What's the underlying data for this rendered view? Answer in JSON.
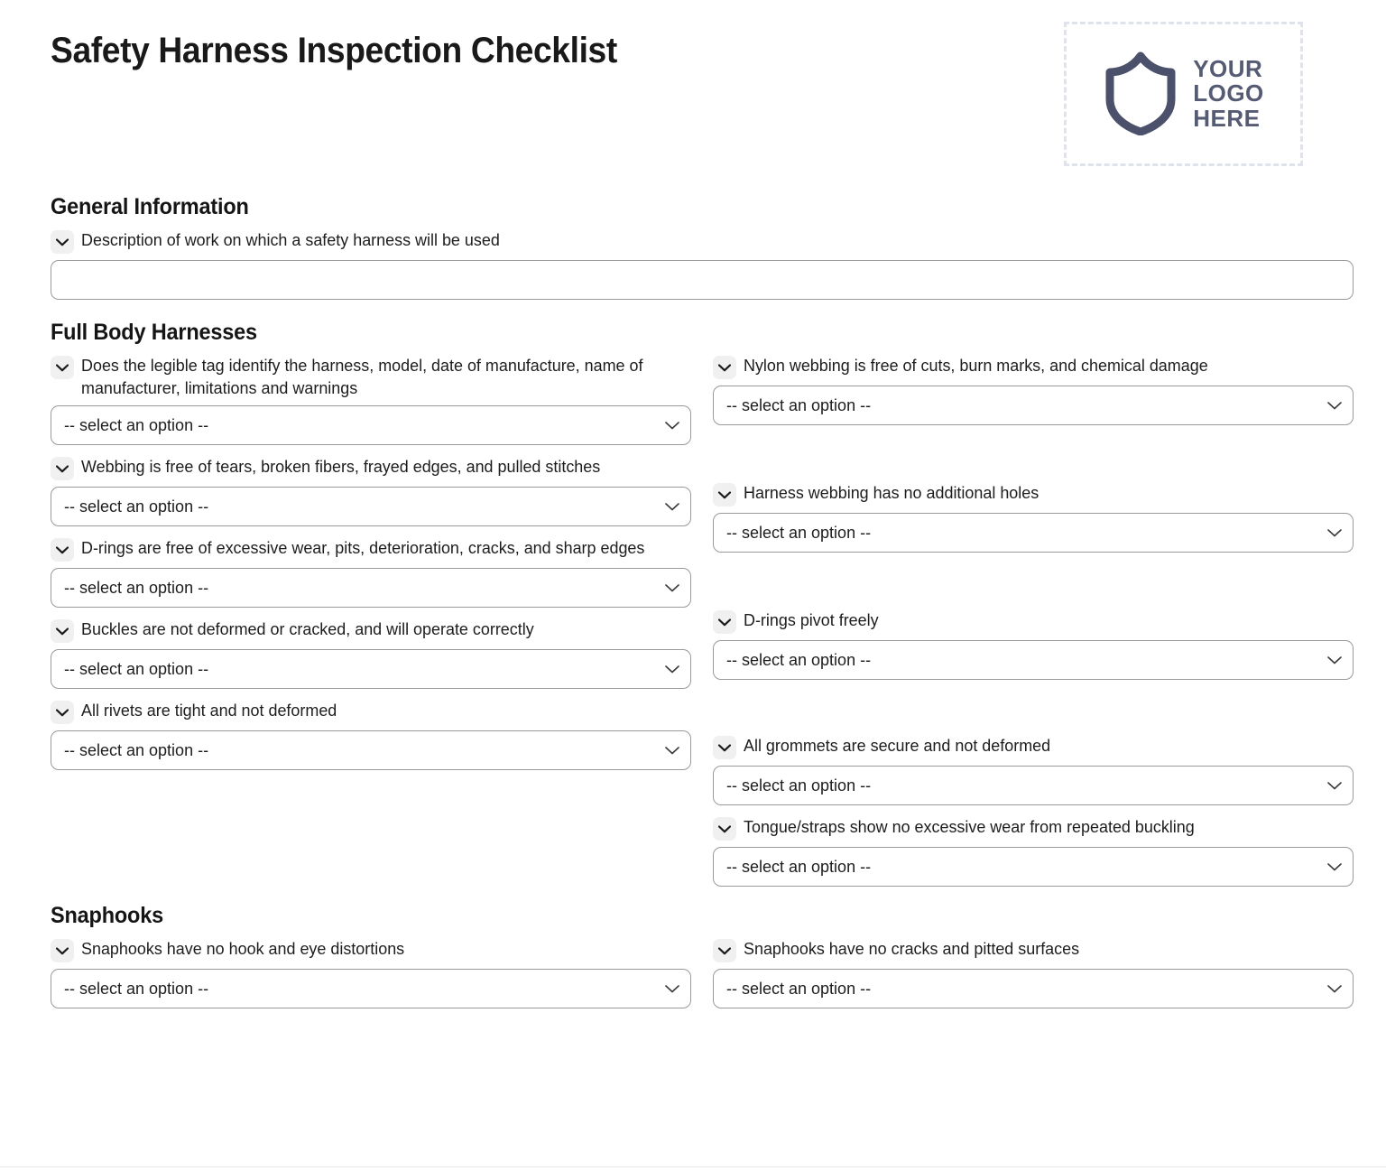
{
  "header": {
    "title": "Safety Harness Inspection Checklist",
    "logo": {
      "icon": "shield-icon",
      "line1": "YOUR",
      "line2": "LOGO",
      "line3": "HERE",
      "border_color": "#dfe3ec",
      "ink_color": "#555b73"
    }
  },
  "select_placeholder": "-- select an option --",
  "sections": [
    {
      "id": "general",
      "heading": "General Information",
      "layout": "single",
      "fields": [
        {
          "label": "Description of work on which a safety harness will be used",
          "control": "text",
          "value": "",
          "placeholder": ""
        }
      ]
    },
    {
      "id": "full-body-harnesses",
      "heading": "Full Body Harnesses",
      "layout": "two-column",
      "left": [
        {
          "label": "Does the legible tag identify the harness, model, date of manufacture, name of manufacturer, limitations and warnings",
          "control": "select",
          "value": "-- select an option --"
        },
        {
          "label": "Webbing is free of tears, broken fibers, frayed edges, and pulled stitches",
          "control": "select",
          "value": "-- select an option --"
        },
        {
          "label": "D-rings are free of excessive wear, pits, deterioration, cracks, and sharp edges",
          "control": "select",
          "value": "-- select an option --"
        },
        {
          "label": "Buckles are not deformed or cracked, and will operate correctly",
          "control": "select",
          "value": "-- select an option --"
        },
        {
          "label": "All rivets are tight and not deformed",
          "control": "select",
          "value": "-- select an option --"
        }
      ],
      "right": [
        {
          "label": "Nylon webbing is free of cuts, burn marks, and chemical damage",
          "control": "select",
          "value": "-- select an option --"
        },
        {
          "label": "Harness webbing has no additional holes",
          "control": "select",
          "value": "-- select an option --"
        },
        {
          "label": "D-rings pivot freely",
          "control": "select",
          "value": "-- select an option --"
        },
        {
          "label": "All grommets are secure and not deformed",
          "control": "select",
          "value": "-- select an option --"
        },
        {
          "label": "Tongue/straps show no excessive wear from repeated buckling",
          "control": "select",
          "value": "-- select an option --"
        }
      ]
    },
    {
      "id": "snaphooks",
      "heading": "Snaphooks",
      "layout": "two-column",
      "left": [
        {
          "label": "Snaphooks have no hook and eye distortions",
          "control": "select",
          "value": "-- select an option --"
        }
      ],
      "right": [
        {
          "label": "Snaphooks have no cracks and pitted surfaces",
          "control": "select",
          "value": "-- select an option --"
        }
      ]
    }
  ]
}
